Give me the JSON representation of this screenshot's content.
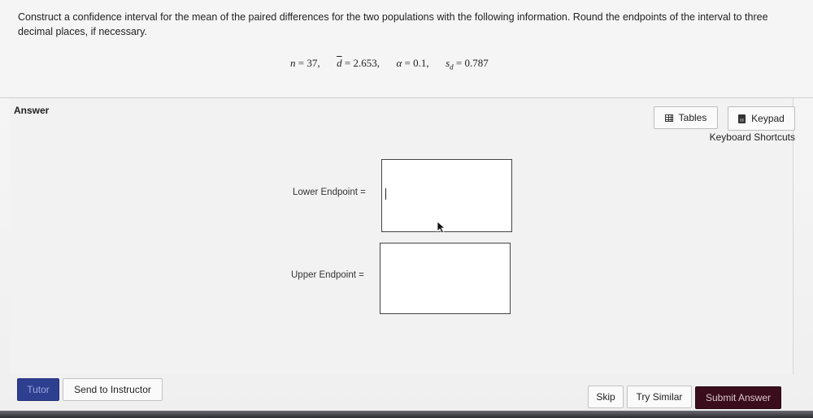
{
  "question": {
    "text": "Construct a confidence interval for the mean of the paired differences for the two populations with the following information. Round the endpoints of the interval to three decimal places, if necessary.",
    "formula": {
      "n_symbol": "n",
      "n_value": "37",
      "d_symbol": "d",
      "d_value": "2.653",
      "alpha_symbol": "α",
      "alpha_value": "0.1",
      "s_symbol": "s",
      "s_sub": "d",
      "s_value": "0.787",
      "equals": "=",
      "comma": ","
    }
  },
  "answer": {
    "label": "Answer",
    "tables_label": "Tables",
    "keypad_label": "Keypad",
    "shortcuts_label": "Keyboard Shortcuts",
    "lower_label": "Lower Endpoint =",
    "upper_label": "Upper Endpoint =",
    "lower_value": "",
    "upper_value": ""
  },
  "footer": {
    "tutor_label": "Tutor",
    "send_label": "Send to Instructor",
    "skip_label": "Skip",
    "similar_label": "Try Similar",
    "submit_label": "Submit Answer"
  },
  "colors": {
    "submit_bg": "#3a0d1c",
    "tutor_bg": "#2f3f8f"
  }
}
